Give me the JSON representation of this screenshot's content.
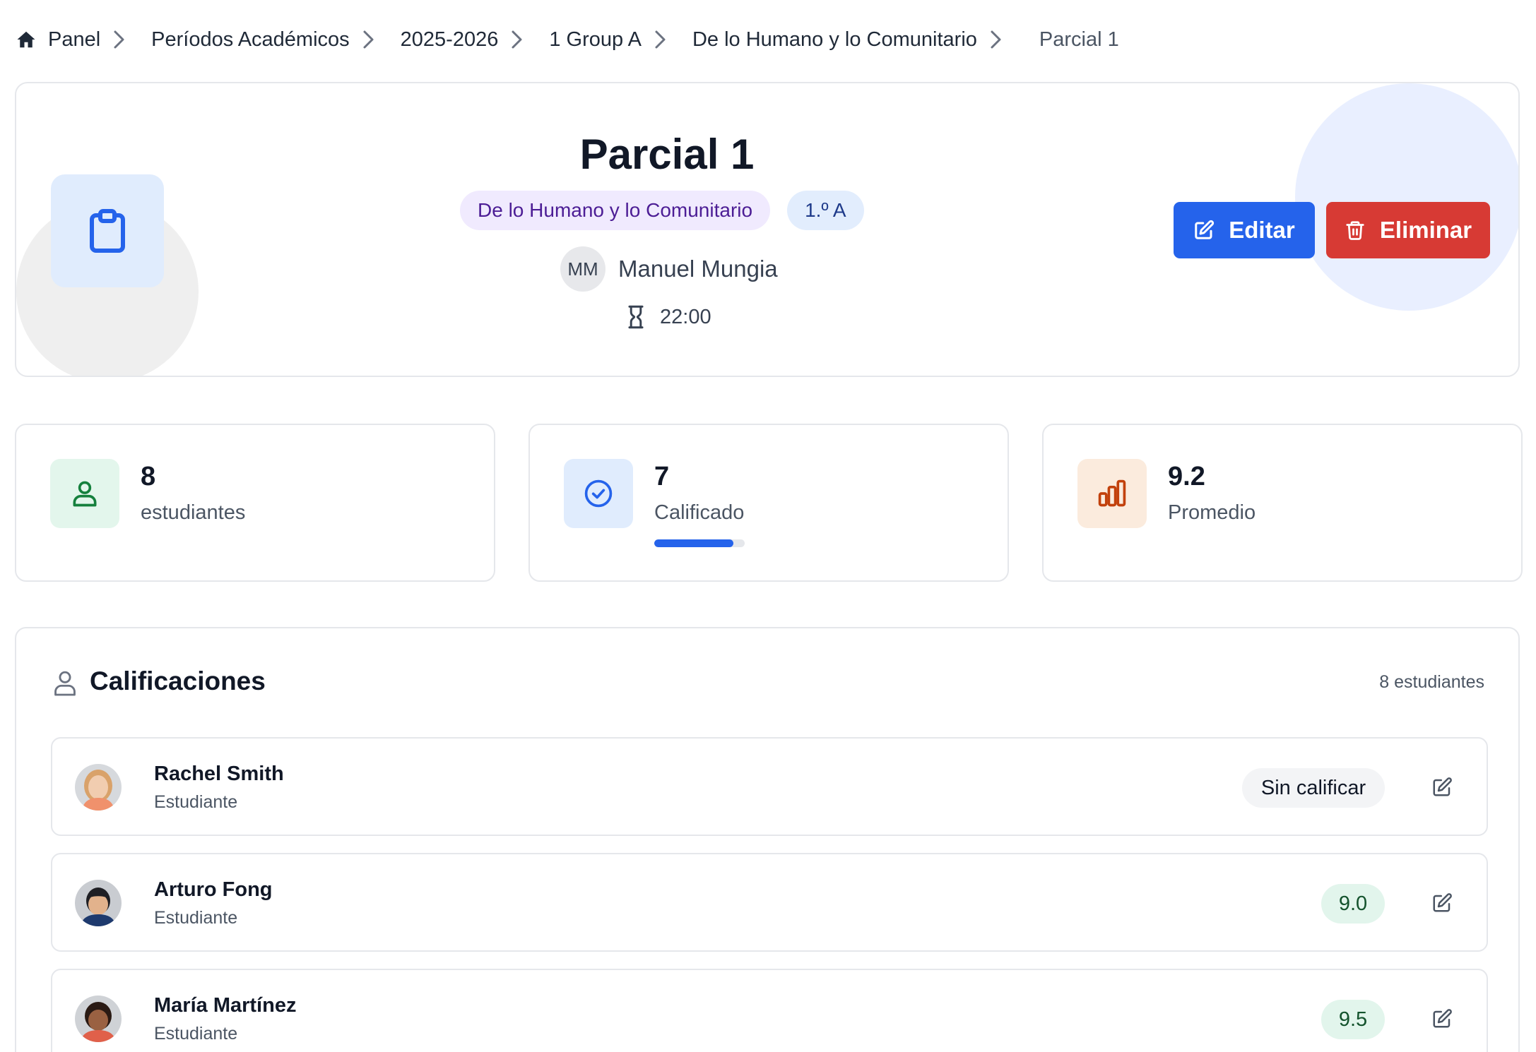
{
  "breadcrumb": {
    "items": [
      "Panel",
      "Períodos Académicos",
      "2025-2026",
      "1 Group A",
      "De lo Humano y lo Comunitario"
    ],
    "current": "Parcial 1"
  },
  "header": {
    "title": "Parcial 1",
    "subject_tag": "De lo Humano y lo Comunitario",
    "group_tag": "1.º A",
    "teacher_initials": "MM",
    "teacher_name": "Manuel Mungia",
    "time": "22:00",
    "edit_label": "Editar",
    "delete_label": "Eliminar"
  },
  "stats": {
    "students": {
      "value": "8",
      "label": "estudiantes"
    },
    "graded": {
      "value": "7",
      "label": "Calificado",
      "progress_fraction": 0.875
    },
    "average": {
      "value": "9.2",
      "label": "Promedio"
    }
  },
  "grades": {
    "title": "Calificaciones",
    "count_label": "8 estudiantes",
    "rows": [
      {
        "name": "Rachel Smith",
        "role": "Estudiante",
        "grade": "Sin calificar",
        "graded": false
      },
      {
        "name": "Arturo Fong",
        "role": "Estudiante",
        "grade": "9.0",
        "graded": true
      },
      {
        "name": "María Martínez",
        "role": "Estudiante",
        "grade": "9.5",
        "graded": true
      }
    ]
  },
  "colors": {
    "primary": "#2563eb",
    "danger": "#d73a34",
    "subject_tag_bg": "#f0eafe",
    "group_tag_bg": "#e2edfd",
    "students_icon_bg": "#e3f6ec",
    "graded_icon_bg": "#e0ecfd",
    "average_icon_bg": "#fbebdd",
    "grade_badge_bg": "#e2f5ec"
  },
  "icons": {
    "home": "home-icon",
    "separator": "chevron-right-icon",
    "header": "clipboard-icon",
    "time": "hourglass-icon",
    "edit": "edit-icon",
    "delete": "trash-icon",
    "students": "user-icon",
    "graded": "check-circle-icon",
    "average": "bar-chart-icon"
  }
}
